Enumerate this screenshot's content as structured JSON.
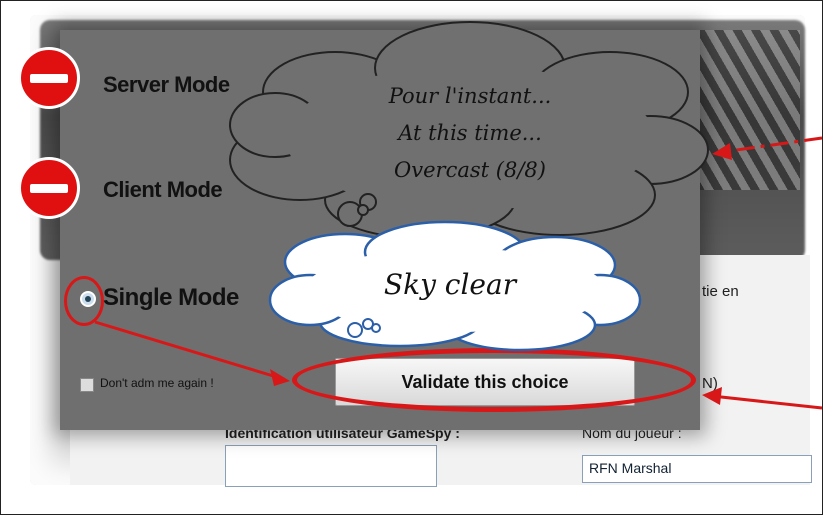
{
  "dialog": {
    "server_mode": "Server Mode",
    "client_mode": "Client Mode",
    "single_mode": "Single  Mode",
    "dont_ask": "Don't adm me again !",
    "validate": "Validate this choice"
  },
  "background": {
    "partie_label": "tie en",
    "user_id_label": "Identification utilisateur GameSpy :",
    "player_name_label": "Nom du joueur :",
    "player_name_value": "RFN Marshal",
    "n_label": "N)"
  },
  "annotations": {
    "cloud_grey_lines": [
      "Pour l'instant...",
      "At this time...",
      "Overcast (8/8)"
    ],
    "cloud_white": "Sky clear"
  },
  "colors": {
    "annotation_red": "#d81818",
    "dialog_grey": "#6f6f6f",
    "cloud_grey": "#707070"
  }
}
